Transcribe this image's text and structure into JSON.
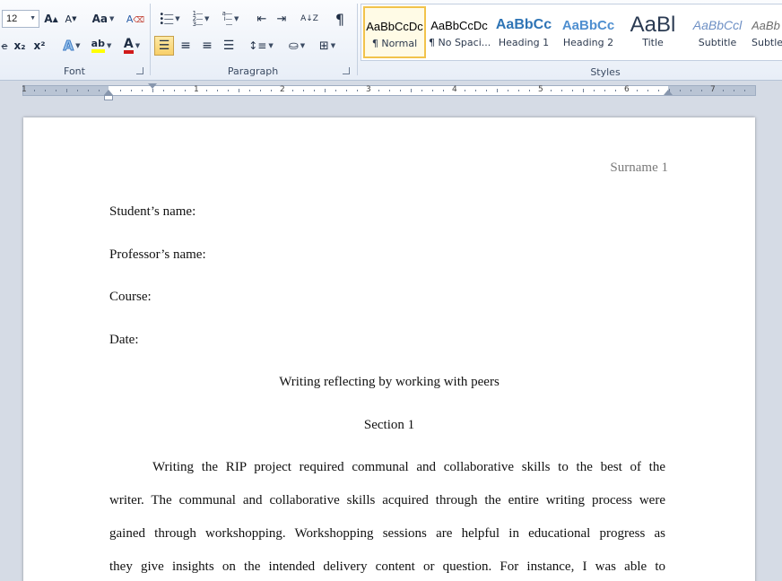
{
  "ribbon": {
    "font": {
      "size_value": "12",
      "label": "Font"
    },
    "paragraph": {
      "label": "Paragraph"
    },
    "styles": {
      "label": "Styles",
      "items": [
        {
          "sample": "AaBbCcDc",
          "name": "¶ Normal"
        },
        {
          "sample": "AaBbCcDc",
          "name": "¶ No Spaci..."
        },
        {
          "sample": "AaBbCc",
          "name": "Heading 1"
        },
        {
          "sample": "AaBbCc",
          "name": "Heading 2"
        },
        {
          "sample": "AaBl",
          "name": "Title"
        },
        {
          "sample": "AaBbCcl",
          "name": "Subtitle"
        },
        {
          "sample": "AaBb",
          "name": "Subtle"
        }
      ]
    },
    "glyphs": {
      "grow_font": "A",
      "shrink_font": "A",
      "change_case": "Aa",
      "clear_format": "A",
      "subscript": "x₂",
      "superscript": "x²",
      "text_effects": "A",
      "highlight": "ab",
      "font_color": "A",
      "strike": "abc",
      "sort": "A↓Z",
      "pilcrow": "¶"
    }
  },
  "ruler": {
    "numbers": [
      "1",
      "1",
      "2",
      "3",
      "4",
      "5",
      "6",
      "7"
    ]
  },
  "document": {
    "header": "Surname 1",
    "lines": [
      "Student’s name:",
      "Professor’s name:",
      "Course:",
      "Date:"
    ],
    "title": "Writing reflecting by working with peers",
    "section": "Section 1",
    "paragraph_lines": [
      "Writing the RIP project required communal and collaborative skills to the best of the",
      "writer. The communal and collaborative skills acquired through the entire writing process were",
      "gained through workshopping. Workshopping sessions are helpful in educational progress as",
      "they give insights on the intended delivery content or question. For instance, I was able to"
    ]
  },
  "colors": {
    "accent_selected_style": "#f2c34b",
    "heading_blue": "#2e74b5",
    "font_color_red": "#d11a1a",
    "highlight_yellow": "#ffff00"
  }
}
